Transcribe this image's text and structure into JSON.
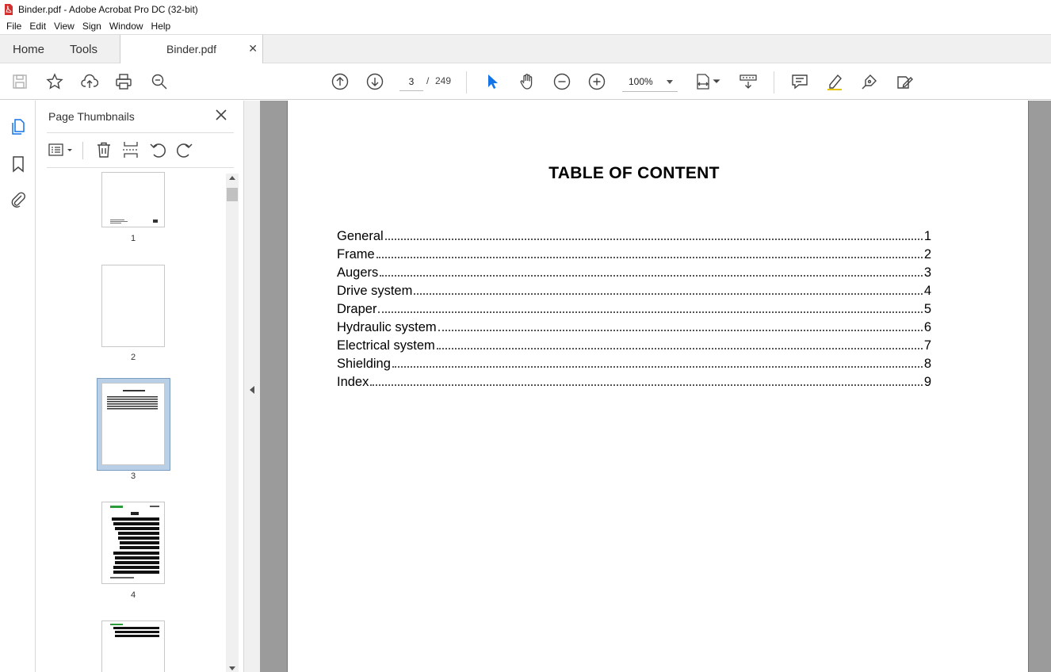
{
  "window": {
    "title": "Binder.pdf - Adobe Acrobat Pro DC (32-bit)"
  },
  "menu": [
    "File",
    "Edit",
    "View",
    "Sign",
    "Window",
    "Help"
  ],
  "tabs": {
    "home": "Home",
    "tools": "Tools",
    "document": "Binder.pdf"
  },
  "toolbar": {
    "current_page": "3",
    "page_separator": "/",
    "total_pages": "249",
    "zoom": "100%",
    "icons": [
      "save-icon",
      "star-icon",
      "upload-icon",
      "print-icon",
      "search-zoom-icon",
      "page-up-icon",
      "page-down-icon",
      "select-cursor-icon",
      "hand-icon",
      "zoom-out-icon",
      "zoom-in-icon",
      "fit-page-icon",
      "scroll-mode-icon",
      "comment-icon",
      "highlight-icon",
      "sign-pen-icon",
      "edit-sign-icon"
    ]
  },
  "sidebar": {
    "panel_title": "Page Thumbnails",
    "thumbnails": [
      {
        "label": "1"
      },
      {
        "label": "2"
      },
      {
        "label": "3",
        "selected": true
      },
      {
        "label": "4"
      }
    ]
  },
  "document": {
    "title": "TABLE OF CONTENT",
    "toc": [
      {
        "label": "General",
        "page": "1"
      },
      {
        "label": "Frame",
        "page": "2"
      },
      {
        "label": "Augers",
        "page": "3"
      },
      {
        "label": "Drive system",
        "page": "4"
      },
      {
        "label": "Draper",
        "page": "5"
      },
      {
        "label": "Hydraulic system",
        "page": "6"
      },
      {
        "label": "Electrical system",
        "page": "7"
      },
      {
        "label": "Shielding",
        "page": "8"
      },
      {
        "label": "Index",
        "page": "9"
      }
    ]
  },
  "colors": {
    "accent": "#1473e6",
    "pdf_red": "#d3302f",
    "page_bg": "#9b9b9b"
  }
}
